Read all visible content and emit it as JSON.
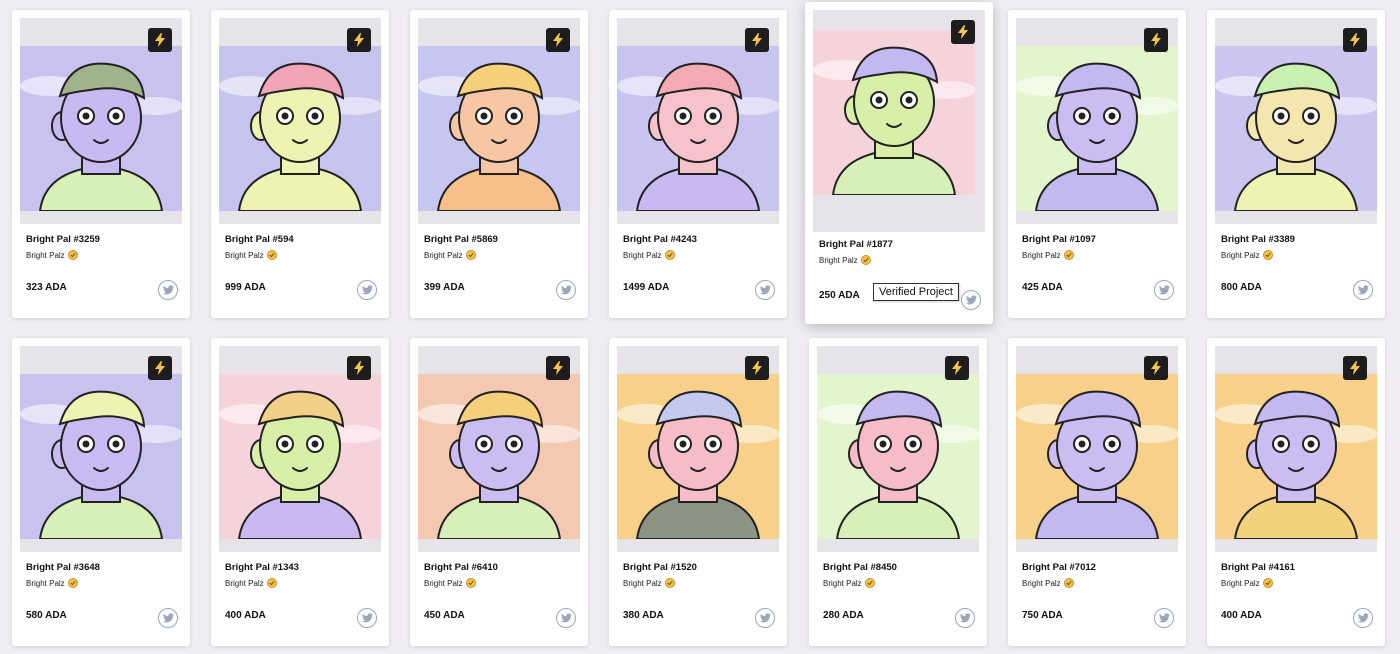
{
  "cards": [
    {
      "name": "Bright Pal #3259",
      "collection": "Bright Palz",
      "price": "323 ADA",
      "bg": "#c9c2ef",
      "skin": "#c8b9f0",
      "hat": "#9fb48a",
      "shirt": "#d6f0b8"
    },
    {
      "name": "Bright Pal #594",
      "collection": "Bright Palz",
      "price": "999 ADA",
      "bg": "#c6c3ee",
      "skin": "#eef2b2",
      "hat": "#f2a5b6",
      "shirt": "#eef2b2"
    },
    {
      "name": "Bright Pal #5869",
      "collection": "Bright Palz",
      "price": "399 ADA",
      "bg": "#c7c6f0",
      "skin": "#f7c7a4",
      "hat": "#f6d07a",
      "shirt": "#f7c08a"
    },
    {
      "name": "Bright Pal #4243",
      "collection": "Bright Palz",
      "price": "1499 ADA",
      "bg": "#c8c3ef",
      "skin": "#f6c3cb",
      "hat": "#f4aab4",
      "shirt": "#c9b9f0"
    },
    {
      "name": "Bright Pal #1877",
      "collection": "Bright Palz",
      "price": "250 ADA",
      "bg": "#f6d3da",
      "skin": "#d8efa9",
      "hat": "#c3b9f0",
      "shirt": "#d6f0b8"
    },
    {
      "name": "Bright Pal #1097",
      "collection": "Bright Palz",
      "price": "425 ADA",
      "bg": "#e2f5cd",
      "skin": "#cbbdf2",
      "hat": "#c3b9f0",
      "shirt": "#c3b9f0"
    },
    {
      "name": "Bright Pal #3389",
      "collection": "Bright Palz",
      "price": "800 ADA",
      "bg": "#cac6f0",
      "skin": "#f3e7b0",
      "hat": "#c9f0b0",
      "shirt": "#eef2b2"
    },
    {
      "name": "Bright Pal #3648",
      "collection": "Bright Palz",
      "price": "580 ADA",
      "bg": "#c7c3ee",
      "skin": "#c9bbf1",
      "hat": "#eef2b2",
      "shirt": "#d6f0b8"
    },
    {
      "name": "Bright Pal #1343",
      "collection": "Bright Palz",
      "price": "400 ADA",
      "bg": "#f6d3da",
      "skin": "#d8efa9",
      "hat": "#f2d088",
      "shirt": "#c9b9f0"
    },
    {
      "name": "Bright Pal #6410",
      "collection": "Bright Palz",
      "price": "450 ADA",
      "bg": "#f5c8b2",
      "skin": "#cbbdf2",
      "hat": "#f6cf7a",
      "shirt": "#d6f0b8"
    },
    {
      "name": "Bright Pal #1520",
      "collection": "Bright Palz",
      "price": "380 ADA",
      "bg": "#f7d18a",
      "skin": "#f6bcc8",
      "hat": "#c3c9ef",
      "shirt": "#8c9484"
    },
    {
      "name": "Bright Pal #8450",
      "collection": "Bright Palz",
      "price": "280 ADA",
      "bg": "#e2f5cd",
      "skin": "#f6bcc8",
      "hat": "#c3b9f0",
      "shirt": "#d6f0b8"
    },
    {
      "name": "Bright Pal #7012",
      "collection": "Bright Palz",
      "price": "750 ADA",
      "bg": "#f7d18a",
      "skin": "#cbbdf2",
      "hat": "#c3b9f0",
      "shirt": "#c3b9f0"
    },
    {
      "name": "Bright Pal #4161",
      "collection": "Bright Palz",
      "price": "400 ADA",
      "bg": "#f7d18a",
      "skin": "#cbbdf2",
      "hat": "#c3b9f0",
      "shirt": "#f3d27d"
    }
  ],
  "tooltip": {
    "text": "Verified Project"
  },
  "icons": {
    "badge": "lightning-icon",
    "verified": "verified-check-icon",
    "social": "twitter-icon"
  }
}
